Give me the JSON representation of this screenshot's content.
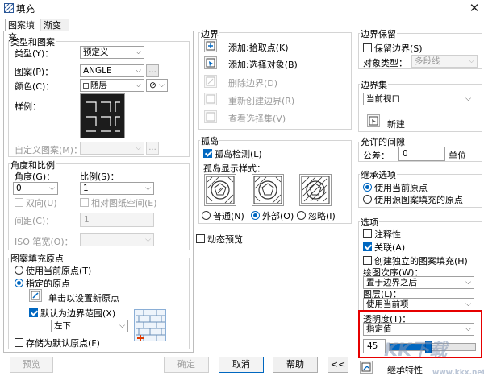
{
  "window": {
    "title": "填充"
  },
  "tabs": [
    {
      "label": "图案填充"
    },
    {
      "label": "渐变色"
    }
  ],
  "type_pattern": {
    "title": "类型和图案",
    "type_label": "类型(Y)：",
    "type_value": "预定义",
    "pattern_label": "图案(P)：",
    "pattern_value": "ANGLE",
    "more_button": "...",
    "color_label": "颜色(C)：",
    "color_value": "随层",
    "bg_value": "⊘",
    "swatch_label": "样例：",
    "custom_label": "自定义图案(M)：",
    "custom_more": "..."
  },
  "angle_scale": {
    "title": "角度和比例",
    "angle_label": "角度(G)：",
    "angle_value": "0",
    "scale_label": "比例(S)：",
    "scale_value": "1",
    "bidirectional": "双向(U)",
    "relative_paper": "相对图纸空间(E)",
    "spacing_label": "间距(C)：",
    "spacing_value": "1",
    "iso_label": "ISO 笔宽(O)："
  },
  "origin": {
    "title": "图案填充原点",
    "use_current": "使用当前原点(T)",
    "specified": "指定的原点",
    "click_set": "单击以设置新原点",
    "default_extent": "默认为边界范围(X)",
    "extent_value": "左下",
    "store_default": "存储为默认原点(F)"
  },
  "boundaries": {
    "title": "边界",
    "add_pick": "添加:拾取点(K)",
    "add_select": "添加:选择对象(B)",
    "remove": "删除边界(D)",
    "recreate": "重新创建边界(R)",
    "view_selection": "查看选择集(V)"
  },
  "islands": {
    "title": "孤岛",
    "detect": "孤岛检测(L)",
    "style_label": "孤岛显示样式：",
    "normal": "普通(N)",
    "outer": "外部(O)",
    "ignore": "忽略(I)"
  },
  "preview_check": "动态预览",
  "boundary_retain": {
    "title": "边界保留",
    "retain": "保留边界(S)",
    "object_type_label": "对象类型：",
    "object_type_value": "多段线"
  },
  "boundary_set": {
    "title": "边界集",
    "value": "当前视口",
    "new_button": "新建"
  },
  "gap": {
    "title": "允许的间隙",
    "tolerance_label": "公差：",
    "tolerance_value": "0",
    "unit": "单位"
  },
  "inherit": {
    "title": "继承选项",
    "use_current": "使用当前原点",
    "use_source": "使用源图案填充的原点"
  },
  "options": {
    "title": "选项",
    "annotative": "注释性",
    "associative": "关联(A)",
    "separate": "创建独立的图案填充(H)",
    "draw_order_label": "绘图次序(W)：",
    "draw_order_value": "置于边界之后",
    "layer_label": "图层(L)：",
    "layer_value": "使用当前项",
    "transparency_label": "透明度(T)：",
    "transparency_value": "指定值",
    "transparency_amount": "45",
    "transparency_fraction": 0.45
  },
  "footer": {
    "preview": "预览",
    "ok": "确定",
    "cancel": "取消",
    "help": "帮助",
    "collapse": "<<",
    "inherit": "继承特性"
  },
  "watermark": {
    "text": "KK下载",
    "url": "www.kkx.net"
  },
  "colors": {
    "accent": "#0067c0",
    "highlight": "#e60000"
  }
}
